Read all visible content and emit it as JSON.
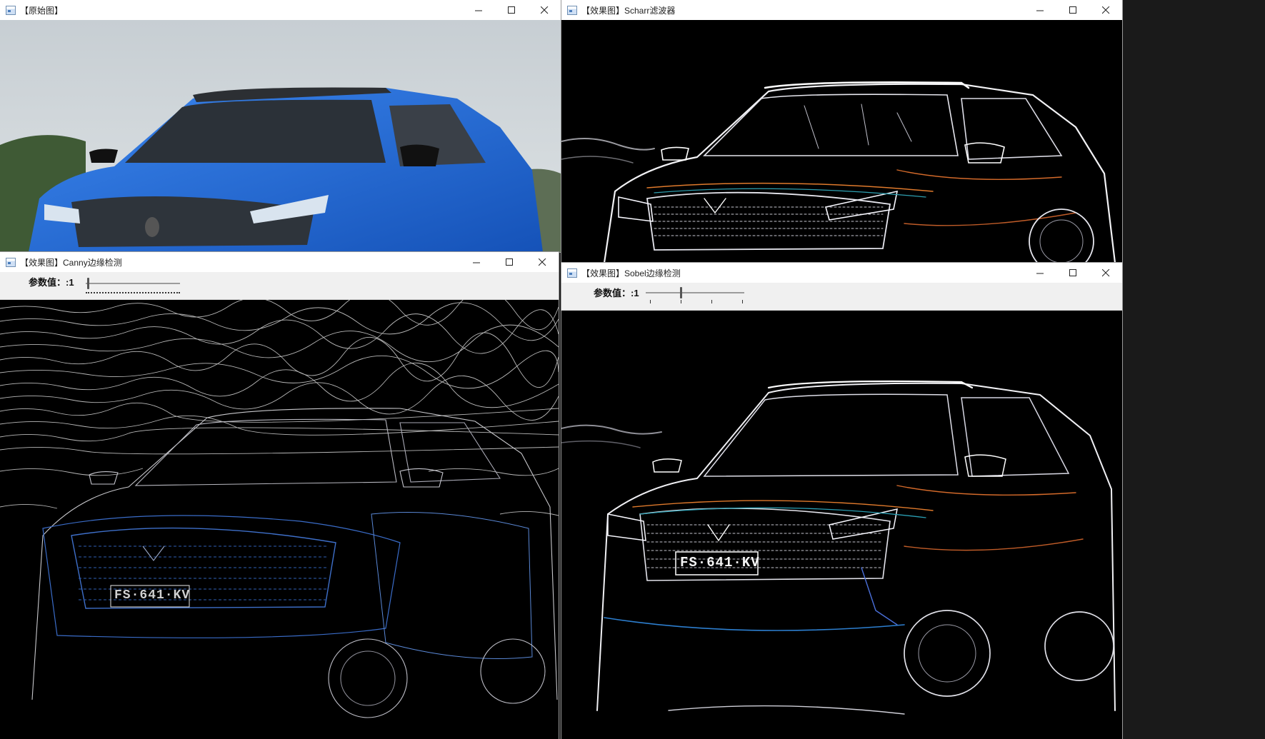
{
  "windows": {
    "original": {
      "title": "【原始图】"
    },
    "scharr": {
      "title": "【效果图】Scharr滤波器"
    },
    "canny": {
      "title": "【效果图】Canny边缘检测",
      "param_label": "参数值：:1",
      "slider_value": 1
    },
    "sobel": {
      "title": "【效果图】Sobel边缘检测",
      "param_label": "参数值：:1",
      "slider_value": 1
    }
  },
  "controls": {
    "minimize": "—",
    "maximize": "☐",
    "close": "✕"
  },
  "plate_text": "FS·641·KV",
  "colors": {
    "car_blue": "#2a6fd6",
    "canny_edges": "#7d8db8",
    "scharr_edges": "#e8e8f0",
    "accent_orange": "#e07a2c",
    "sky": "#c9d1d6"
  }
}
